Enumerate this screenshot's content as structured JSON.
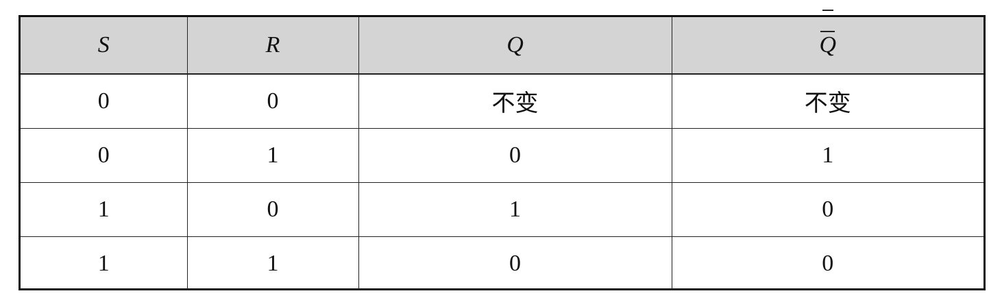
{
  "truth_table": {
    "headers": [
      "S",
      "R",
      "Q",
      "Q"
    ],
    "rows": [
      [
        "0",
        "0",
        "不变",
        "不变"
      ],
      [
        "0",
        "1",
        "0",
        "1"
      ],
      [
        "1",
        "0",
        "1",
        "0"
      ],
      [
        "1",
        "1",
        "0",
        "0"
      ]
    ]
  }
}
